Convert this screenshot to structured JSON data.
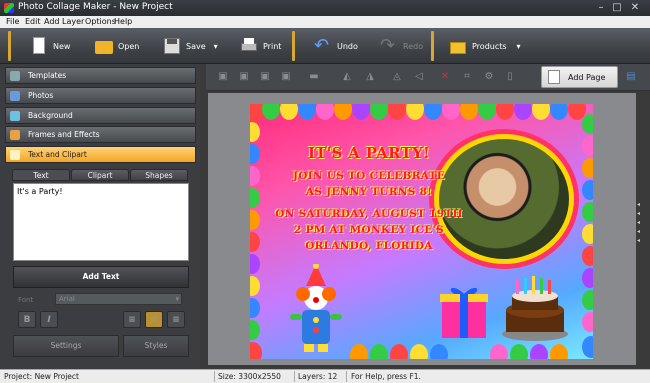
{
  "window": {
    "title": "Photo Collage Maker - New Project"
  },
  "menu": [
    "File",
    "Edit",
    "Add",
    "Layer",
    "Options",
    "Help"
  ],
  "toolbar": {
    "new": "New",
    "open": "Open",
    "save": "Save",
    "print": "Print",
    "undo": "Undo",
    "redo": "Redo",
    "products": "Products"
  },
  "panels": {
    "templates": "Templates",
    "photos": "Photos",
    "background": "Background",
    "frames": "Frames and Effects",
    "text_clipart": "Text and Clipart"
  },
  "tabs": {
    "text": "Text",
    "clipart": "Clipart",
    "shapes": "Shapes"
  },
  "text_editor": {
    "value": "It's a Party!"
  },
  "add_text": "Add Text",
  "font": {
    "label": "Font",
    "value": "Arial"
  },
  "format": {
    "bold": "B",
    "italic": "I"
  },
  "settings": "Settings",
  "styles": "Styles",
  "add_page": "Add Page",
  "card": {
    "line1": "IT'S A PARTY!",
    "line2": "JOIN US TO CELEBRATE",
    "line3": "AS JENNY TURNS 8!",
    "line4": "ON SATURDAY, AUGUST 19TH",
    "line5": "2 PM AT MONKEY ICE'S",
    "line6": "ORLANDO, FLORIDA"
  },
  "status": {
    "project": "Project: New Project",
    "size": "Size: 3300x2550",
    "layers": "Layers: 12",
    "help": "For Help, press F1."
  },
  "colors": {
    "accent": "#f5a623",
    "card_text": "#ff1a1a"
  }
}
